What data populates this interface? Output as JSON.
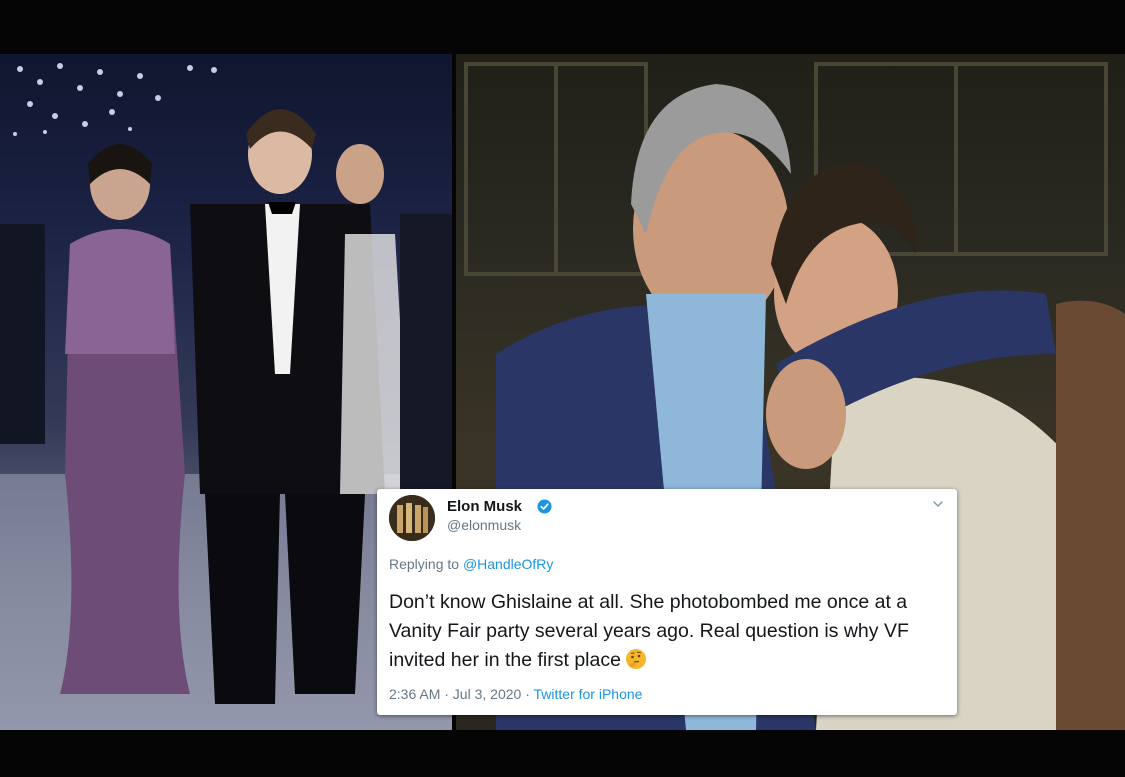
{
  "tweet": {
    "display_name": "Elon Musk",
    "handle": "@elonmusk",
    "replying_prefix": "Replying to ",
    "replying_handle": "@HandleOfRy",
    "text": "Don’t know Ghislaine at all. She photobombed me once at a Vanity Fair party several years ago. Real question is why VF invited her in the first place",
    "emoji": "thinking-face",
    "timestamp": "2:36 AM · Jul 3, 2020 · ",
    "source": "Twitter for iPhone",
    "verified_badge": "verified-icon"
  },
  "colors": {
    "twitter_blue": "#1b95e0",
    "text_dark": "#14171a",
    "text_gray": "#657786"
  }
}
